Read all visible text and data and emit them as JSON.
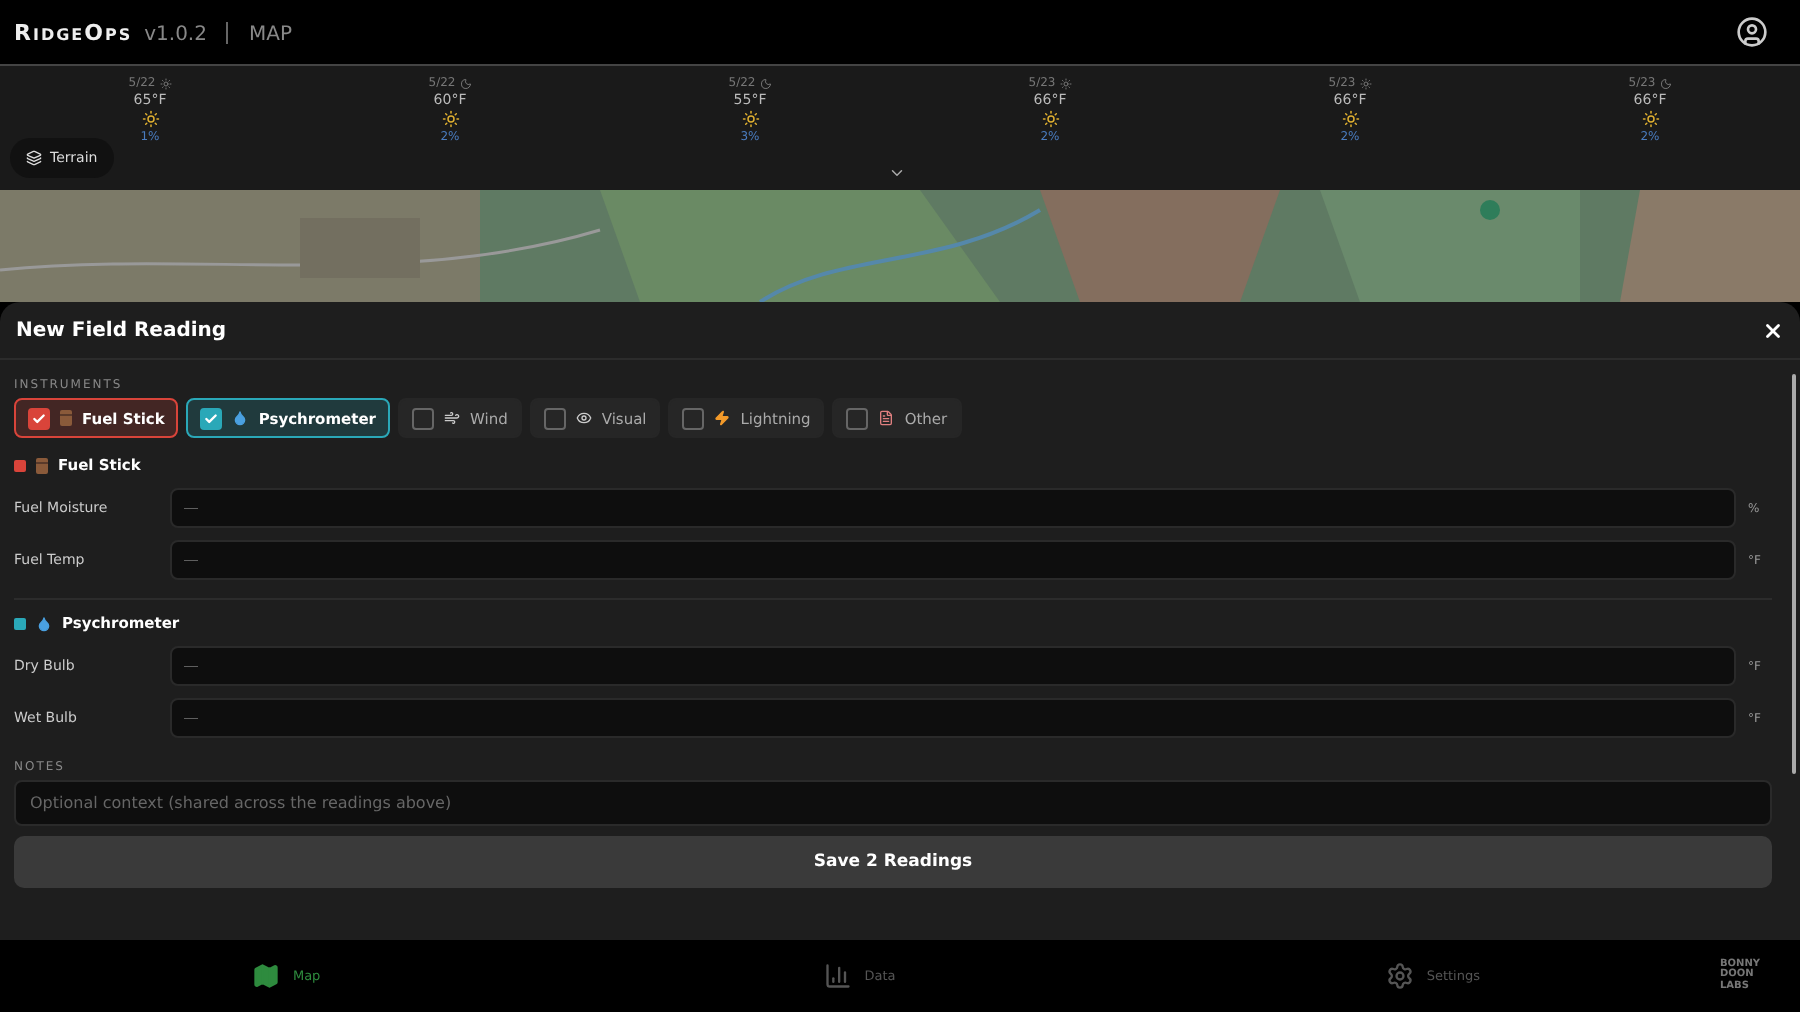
{
  "app": {
    "name": "RidgeOps",
    "version": "v1.0.2",
    "section": "MAP"
  },
  "forecast": [
    {
      "date": "5/22",
      "kind": "day",
      "temp": "65°F",
      "precip": "1%"
    },
    {
      "date": "5/22",
      "kind": "night",
      "temp": "60°F",
      "precip": "2%"
    },
    {
      "date": "5/22",
      "kind": "night",
      "temp": "55°F",
      "precip": "3%"
    },
    {
      "date": "5/23",
      "kind": "day",
      "temp": "66°F",
      "precip": "2%"
    },
    {
      "date": "5/23",
      "kind": "day",
      "temp": "66°F",
      "precip": "2%"
    },
    {
      "date": "5/23",
      "kind": "night",
      "temp": "66°F",
      "precip": "2%"
    }
  ],
  "map": {
    "kind": "picture",
    "layer_button": "Terrain"
  },
  "sheet": {
    "title": "New Field Reading",
    "instruments_label": "INSTRUMENTS",
    "instruments": [
      {
        "label": "Fuel Stick",
        "kind": "fuel",
        "selected": true,
        "color": "#d9443a"
      },
      {
        "label": "Psychrometer",
        "kind": "psychro",
        "selected": true,
        "color": "#2aa8b8"
      },
      {
        "label": "Wind",
        "kind": "wind",
        "selected": false
      },
      {
        "label": "Visual",
        "kind": "visual",
        "selected": false
      },
      {
        "label": "Lightning",
        "kind": "lightning",
        "selected": false
      },
      {
        "label": "Other",
        "kind": "other",
        "selected": false
      }
    ],
    "sections": [
      {
        "title": "Fuel Stick",
        "kind": "fuel",
        "color": "#d9443a",
        "fields": [
          {
            "label": "Fuel Moisture",
            "placeholder": "—",
            "unit": "%"
          },
          {
            "label": "Fuel Temp",
            "placeholder": "—",
            "unit": "°F"
          }
        ]
      },
      {
        "title": "Psychrometer",
        "kind": "psychro",
        "color": "#2aa8b8",
        "fields": [
          {
            "label": "Dry Bulb",
            "placeholder": "—",
            "unit": "°F"
          },
          {
            "label": "Wet Bulb",
            "placeholder": "—",
            "unit": "°F"
          }
        ]
      }
    ],
    "notes_label": "NOTES",
    "notes_placeholder": "Optional context (shared across the readings above)",
    "save": "Save 2 Readings"
  },
  "nav": [
    {
      "label": "Map",
      "kind": "map",
      "selected": true
    },
    {
      "label": "Data",
      "kind": "data",
      "selected": false
    },
    {
      "label": "Settings",
      "kind": "settings",
      "selected": false
    }
  ],
  "logo": [
    "BONNY",
    "DOON",
    "LABS"
  ]
}
